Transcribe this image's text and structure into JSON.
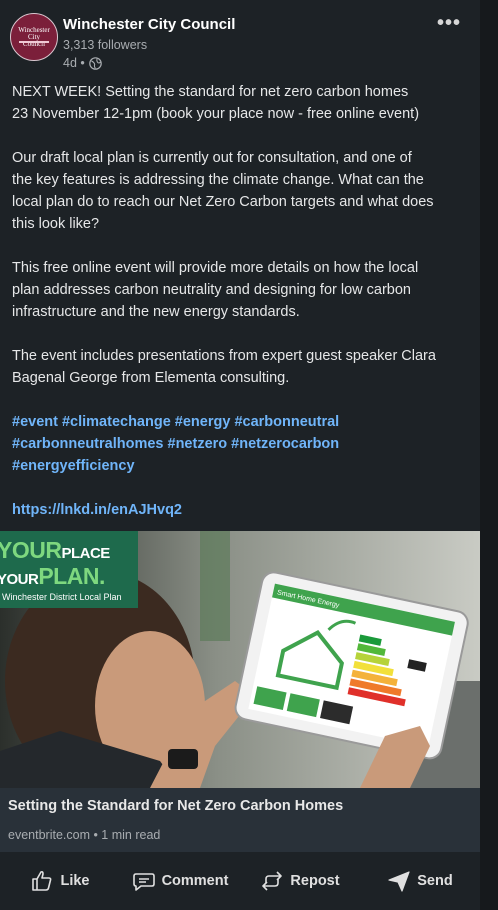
{
  "post": {
    "author": "Winchester City Council",
    "followers": "3,313 followers",
    "time": "4d •",
    "avatar_text": "Winchester City Council",
    "more_label": "•••",
    "paragraphs": [
      [
        "NEXT WEEK! Setting the standard for net zero carbon homes",
        "23 November 12-1pm (book your place now - free online event)"
      ],
      [
        "Our draft local plan is currently out for consultation, and one of",
        "the key features is addressing the climate change. What can the",
        "local plan do to reach our Net Zero Carbon targets and what does",
        "this look like?"
      ],
      [
        "This free online event will provide more details on how the local",
        "plan addresses carbon neutrality and designing for low carbon",
        "infrastructure and the new energy standards."
      ],
      [
        "The event includes presentations from expert guest speaker Clara",
        "Bagenal George from Elementa consulting."
      ]
    ],
    "hashtag_lines": [
      "#event #climatechange #energy #carbonneutral",
      "#carbonneutralhomes #netzero #netzerocarbon",
      "#energyefficiency"
    ],
    "link": "https://lnkd.in/enAJHvq2"
  },
  "image": {
    "brand_your": "YOUR",
    "brand_place": "PLACE",
    "brand_your2": "YOUR",
    "brand_plan": "PLAN.",
    "brand_sub": "Winchester District Local Plan",
    "tablet_header": "Smart Home Energy"
  },
  "preview": {
    "title": "Setting the Standard for Net Zero Carbon Homes",
    "meta": "eventbrite.com • 1 min read"
  },
  "actions": {
    "like": "Like",
    "comment": "Comment",
    "repost": "Repost",
    "send": "Send"
  },
  "colors": {
    "accent_link": "#70b5f9",
    "card_bg": "#1d2226",
    "brand_green": "#1e6a4c"
  }
}
